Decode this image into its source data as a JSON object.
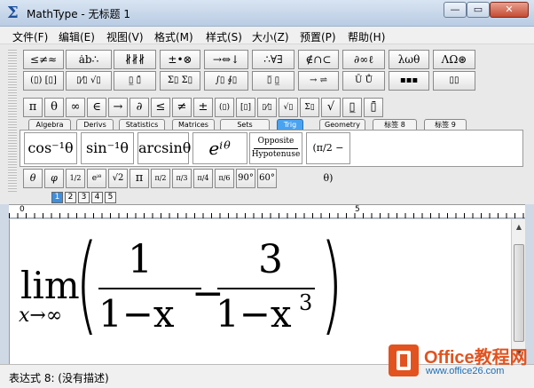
{
  "window": {
    "title": "MathType - 无标题 1",
    "minimize_label": "—",
    "maximize_label": "▭",
    "close_label": "✕"
  },
  "menu": [
    {
      "label": "文件(F)"
    },
    {
      "label": "编辑(E)"
    },
    {
      "label": "视图(V)"
    },
    {
      "label": "格式(M)"
    },
    {
      "label": "样式(S)"
    },
    {
      "label": "大小(Z)"
    },
    {
      "label": "预置(P)"
    },
    {
      "label": "帮助(H)"
    }
  ],
  "palette_row1": [
    "≤≠≈",
    "ȧb∴",
    "∦∦∦",
    "±•⊗",
    "→⇔↓",
    "∴∀∃",
    "∉∩⊂",
    "∂∞ℓ",
    "λωθ",
    "ΛΩ⊛"
  ],
  "palette_row2": [
    "(▯) [▯]",
    "▯⁄▯ √▯",
    "▯̲ ▯̄",
    "Σ▯ Σ▯",
    "∫▯ ∮▯",
    "▯̅ ▯̲",
    "→ ⇌",
    "Ū Ů",
    "▪▪▪",
    "▯▯"
  ],
  "symbol_row": [
    "π",
    "θ",
    "∞",
    "∈",
    "→",
    "∂",
    "≤",
    "≠",
    "±",
    "(▯)",
    "[▯]",
    "▯⁄▯",
    "√▯",
    "Σ▯",
    "√",
    "▯̲",
    "▯̄"
  ],
  "tabs": [
    {
      "label": "Algebra",
      "active": false
    },
    {
      "label": "Derivs",
      "active": false
    },
    {
      "label": "Statistics",
      "active": false
    },
    {
      "label": "Matrices",
      "active": false
    },
    {
      "label": "Sets",
      "active": false
    },
    {
      "label": "Trig",
      "active": true
    },
    {
      "label": "Geometry",
      "active": false
    },
    {
      "label": "标签 8",
      "active": false
    },
    {
      "label": "标签 9",
      "active": false
    }
  ],
  "trig_templates": {
    "cos_inv": "cos⁻¹θ",
    "sin_inv": "sin⁻¹θ",
    "arcsin": "arcsinθ",
    "exp": "eⁱᶿ",
    "opposite": "Opposite",
    "hypotenuse": "Hypotenuse",
    "pi_half": "(π/2 − θ)"
  },
  "small_row": [
    "θ",
    "φ",
    "1/2",
    "eⁱᶿ",
    "√2",
    "π",
    "π/2",
    "π/3",
    "π/4",
    "π/6",
    "90°",
    "60°"
  ],
  "mini_tabs": [
    "1",
    "2",
    "3",
    "4",
    "5"
  ],
  "ruler": {
    "start": "0",
    "mid": "5"
  },
  "formula": {
    "lim": "lim",
    "sub": "x→∞",
    "num1": "1",
    "den1": "1−x",
    "minus": "−",
    "num2": "3",
    "den2": "1−x",
    "exp": "3"
  },
  "status": {
    "text": "表达式 8: (没有描述)"
  },
  "watermark": {
    "title": "Office教程网",
    "url": "www.office26.com"
  },
  "colors": {
    "active_tab": "#4aa3f0",
    "watermark": "#e2531f",
    "close": "#c44a32"
  }
}
